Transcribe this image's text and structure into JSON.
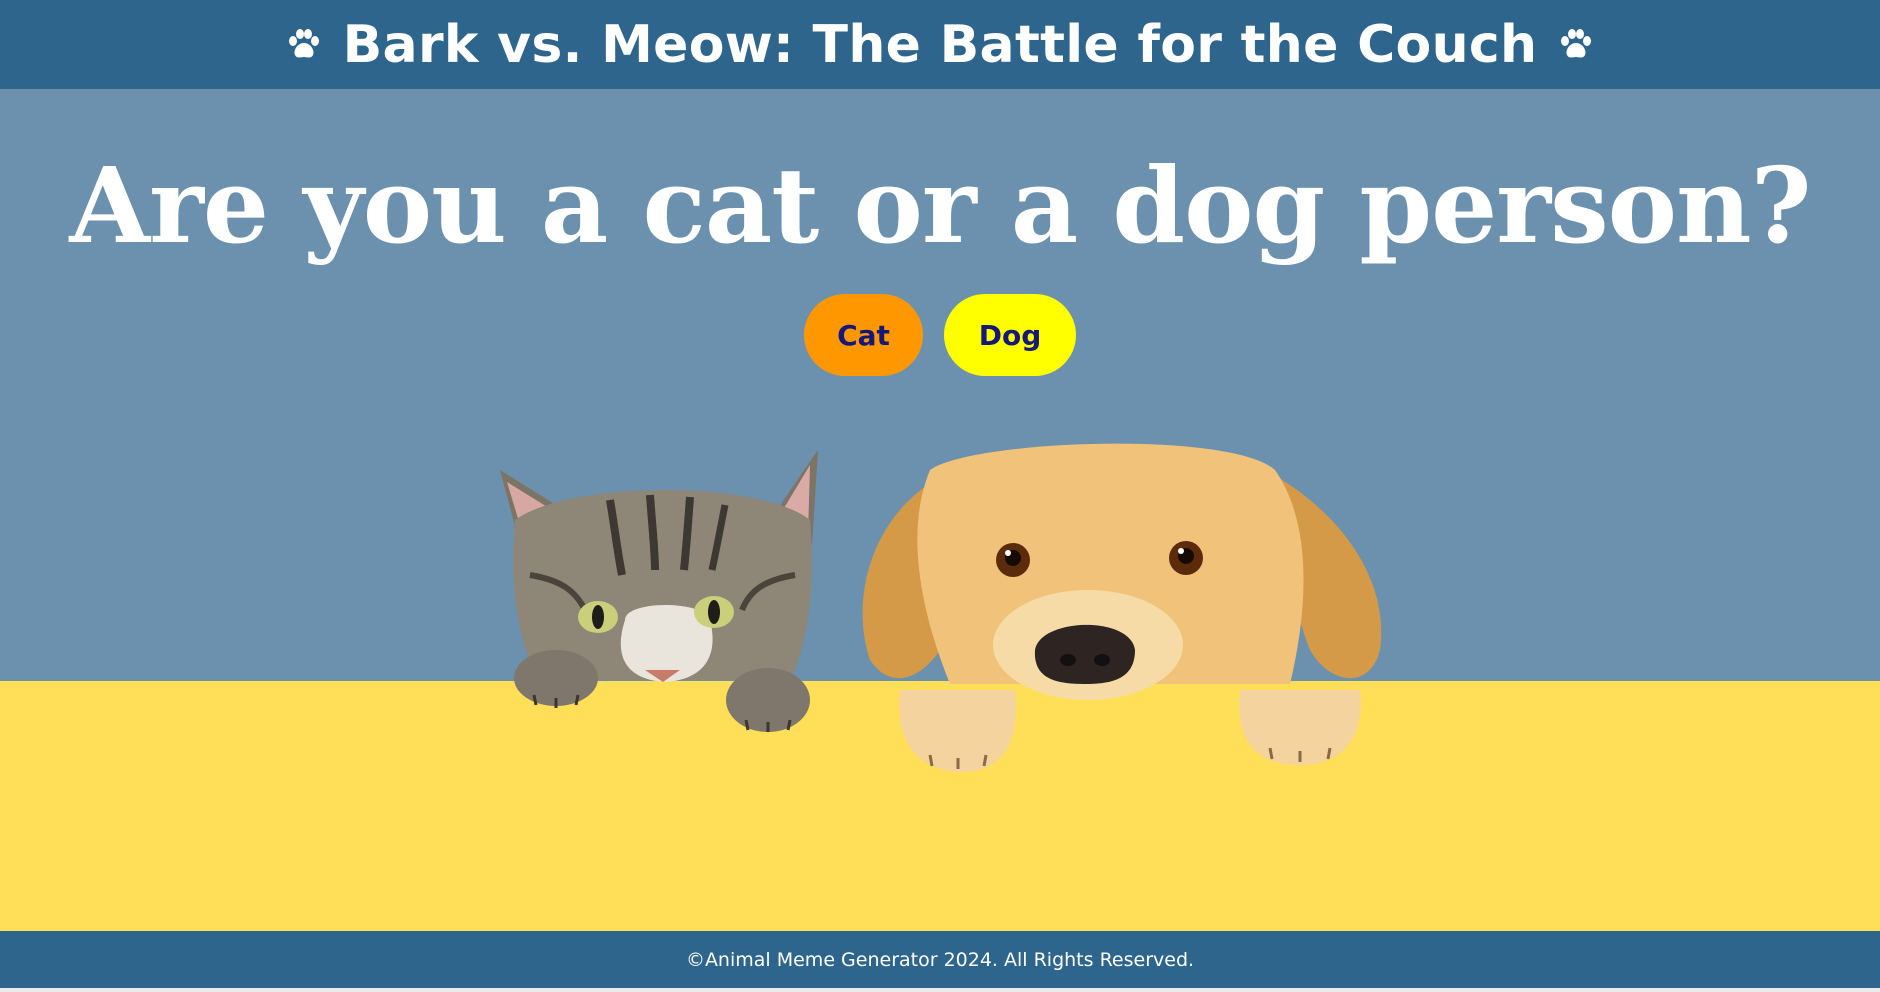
{
  "header": {
    "title": "Bark vs. Meow: The Battle for the Couch",
    "left_icon": "paw-icon",
    "right_icon": "paw-icon"
  },
  "hero": {
    "question": "Are you a cat or a dog person?",
    "buttons": [
      {
        "label": "Cat",
        "color": "#ff9800"
      },
      {
        "label": "Dog",
        "color": "#ffff00"
      }
    ],
    "image": "cat-and-dog-peeking"
  },
  "footer": {
    "text": "©Animal Meme Generator 2024. All Rights Reserved."
  },
  "colors": {
    "header_bg": "#2e658c",
    "hero_bg": "#6b91ae",
    "ledge_bg": "#ffdf57",
    "button_text": "#15187a"
  }
}
